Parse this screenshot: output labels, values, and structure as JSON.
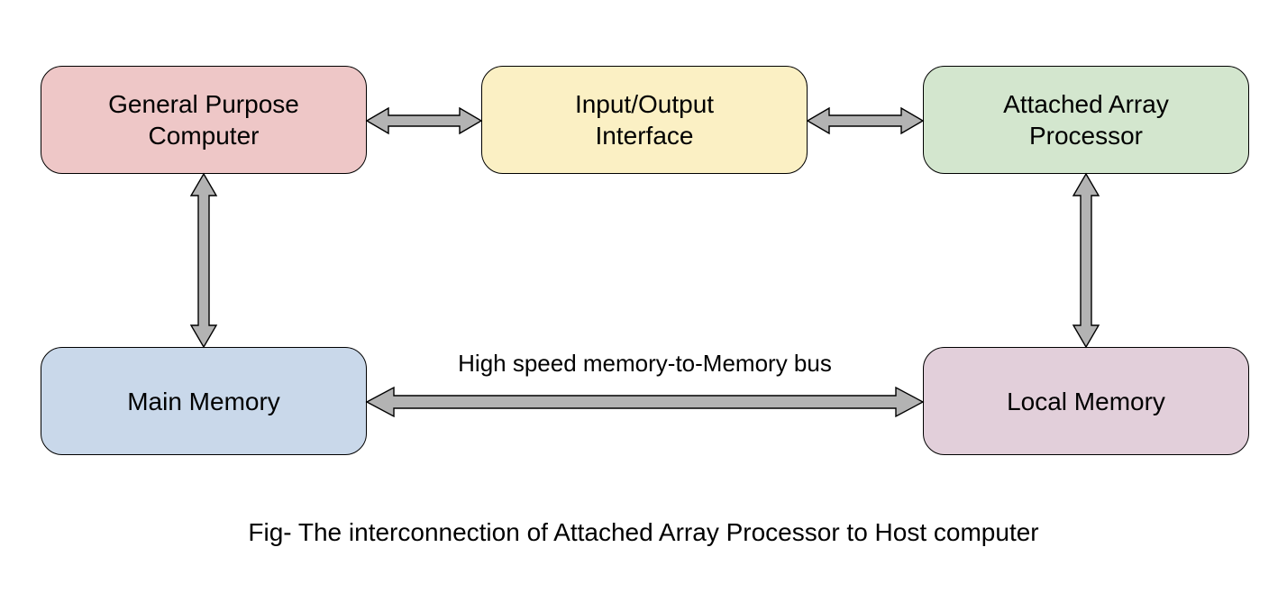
{
  "nodes": {
    "general_purpose_computer": {
      "label": "General Purpose\nComputer",
      "fill": "#eec7c7"
    },
    "io_interface": {
      "label": "Input/Output\nInterface",
      "fill": "#fbf0c4"
    },
    "attached_array_processor": {
      "label": "Attached Array\nProcessor",
      "fill": "#d3e6ce"
    },
    "main_memory": {
      "label": "Main Memory",
      "fill": "#c9d8ea"
    },
    "local_memory": {
      "label": "Local Memory",
      "fill": "#e2cfda"
    }
  },
  "labels": {
    "bus": "High speed memory-to-Memory bus",
    "caption": "Fig- The interconnection of Attached Array Processor to Host computer"
  },
  "connectors": [
    {
      "from": "general_purpose_computer",
      "to": "io_interface",
      "dir": "horizontal",
      "bidirectional": true
    },
    {
      "from": "io_interface",
      "to": "attached_array_processor",
      "dir": "horizontal",
      "bidirectional": true
    },
    {
      "from": "general_purpose_computer",
      "to": "main_memory",
      "dir": "vertical",
      "bidirectional": true
    },
    {
      "from": "attached_array_processor",
      "to": "local_memory",
      "dir": "vertical",
      "bidirectional": true
    },
    {
      "from": "main_memory",
      "to": "local_memory",
      "dir": "horizontal",
      "bidirectional": true,
      "label": "bus"
    }
  ],
  "arrow_style": {
    "fill": "#b3b3b3",
    "stroke": "#000000"
  }
}
